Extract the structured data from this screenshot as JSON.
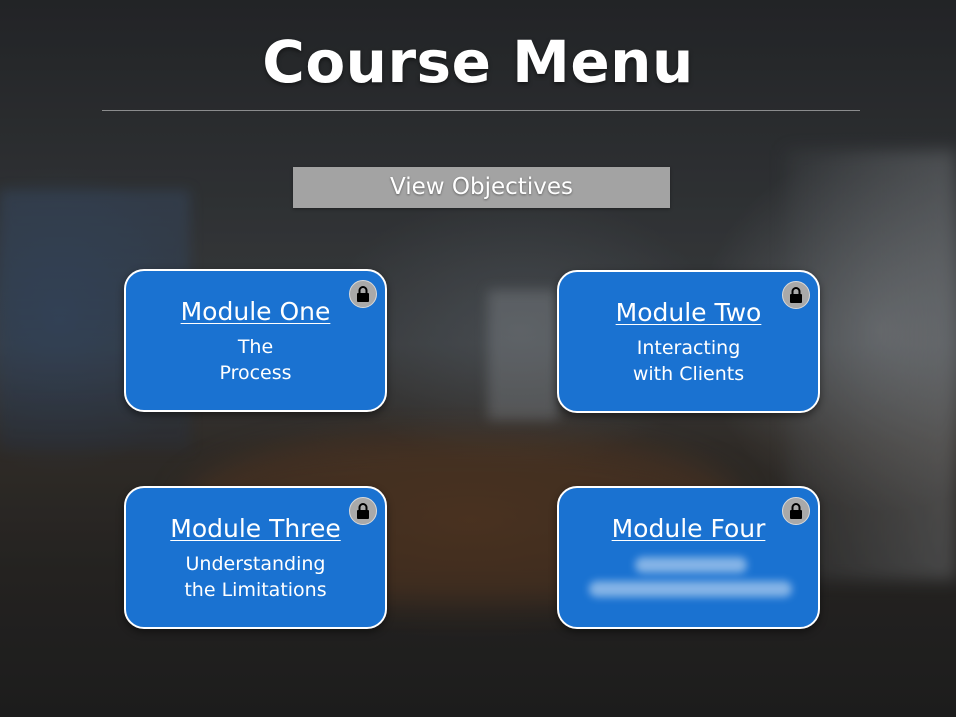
{
  "header": {
    "title": "Course Menu"
  },
  "objectives_button": {
    "label": "View Objectives"
  },
  "modules": [
    {
      "title": "Module One",
      "subtitle_lines": [
        "The",
        "Process"
      ],
      "locked": true,
      "icon": "lock-icon"
    },
    {
      "title": "Module Two",
      "subtitle_lines": [
        "Interacting",
        "with Clients"
      ],
      "locked": true,
      "icon": "lock-icon"
    },
    {
      "title": "Module Three",
      "subtitle_lines": [
        "Understanding",
        "the Limitations"
      ],
      "locked": true,
      "icon": "lock-icon"
    },
    {
      "title": "Module Four",
      "subtitle_lines": [],
      "locked": true,
      "icon": "lock-icon"
    }
  ],
  "colors": {
    "module_fill": "#1a72d1",
    "module_border": "#ffffff",
    "objectives_button": "#a3a3a3",
    "lock_badge": "#a9a9a9"
  }
}
